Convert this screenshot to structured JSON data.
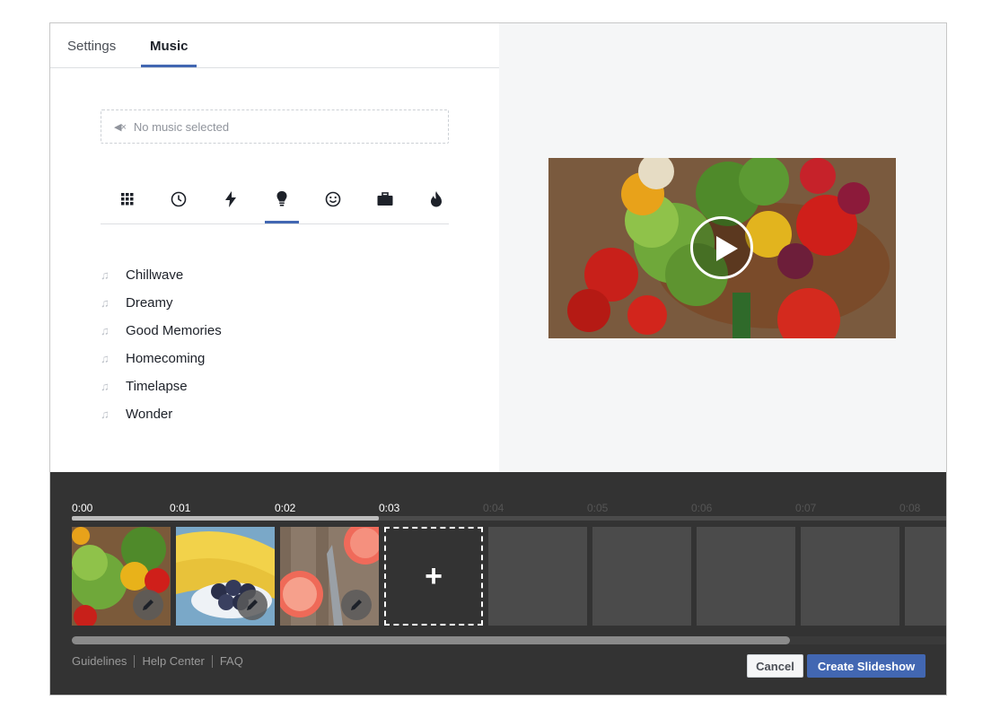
{
  "tabs": {
    "settings": "Settings",
    "music": "Music"
  },
  "music": {
    "no_music": "No music selected",
    "categories": [
      "all-icon",
      "clock-icon",
      "lightning-icon",
      "lightbulb-icon",
      "smiley-icon",
      "briefcase-icon",
      "fire-icon"
    ],
    "active_category": "lightbulb-icon",
    "songs": [
      "Chillwave",
      "Dreamy",
      "Good Memories",
      "Homecoming",
      "Timelapse",
      "Wonder"
    ]
  },
  "timeline": {
    "ticks": [
      "0:00",
      "0:01",
      "0:02",
      "0:03",
      "0:04",
      "0:05",
      "0:06",
      "0:07",
      "0:08"
    ],
    "progress": 0.35,
    "add_label": "+"
  },
  "footer": {
    "guidelines": "Guidelines",
    "help_center": "Help Center",
    "faq": "FAQ",
    "cancel": "Cancel",
    "create": "Create Slideshow"
  },
  "colors": {
    "accent": "#4267b2",
    "timeline_bg": "#333333",
    "panel_bg": "#f5f6f7"
  }
}
